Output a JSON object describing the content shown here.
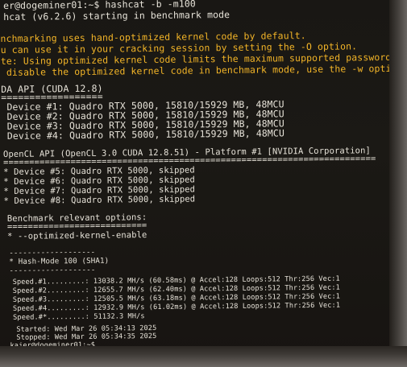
{
  "terminal": {
    "lines": {
      "l1": "er@dogeminer01:~$ hashcat -b -m100",
      "l2": "hcat (v6.2.6) starting in benchmark mode",
      "l3": "nchmarking uses hand-optimized kernel code by default.",
      "l4": "u can use it in your cracking session by setting the -O option.",
      "l5": "te: Using optimized kernel code limits the maximum supported password length.",
      "l6": " disable the optimized kernel code in benchmark mode, use the -w option.",
      "l7": "DA API (CUDA 12.8)",
      "l8": "==================",
      "l9": " Device #1: Quadro RTX 5000, 15810/15929 MB, 48MCU",
      "l10": " Device #2: Quadro RTX 5000, 15810/15929 MB, 48MCU",
      "l11": " Device #3: Quadro RTX 5000, 15810/15929 MB, 48MCU",
      "l12": " Device #4: Quadro RTX 5000, 15810/15929 MB, 48MCU",
      "l13": "OpenCL API (OpenCL 3.0 CUDA 12.8.51) - Platform #1 [NVIDIA Corporation]",
      "l14": "========================================================================",
      "l15": "* Device #5: Quadro RTX 5000, skipped",
      "l16": "* Device #6: Quadro RTX 5000, skipped",
      "l17": "* Device #7: Quadro RTX 5000, skipped",
      "l18": "* Device #8: Quadro RTX 5000, skipped",
      "l19": "Benchmark relevant options:",
      "l20": "===========================",
      "l21": "* --optimized-kernel-enable",
      "l22": "-------------------",
      "l23": "* Hash-Mode 100 (SHA1)",
      "l24": "-------------------",
      "l25": "Speed.#1.........: 13038.2 MH/s (60.58ms) @ Accel:128 Loops:512 Thr:256 Vec:1",
      "l26": "Speed.#2.........: 12655.7 MH/s (62.40ms) @ Accel:128 Loops:512 Thr:256 Vec:1",
      "l27": "Speed.#3.........: 12505.5 MH/s (63.18ms) @ Accel:128 Loops:512 Thr:256 Vec:1",
      "l28": "Speed.#4.........: 12932.9 MH/s (61.02ms) @ Accel:128 Loops:512 Thr:256 Vec:1",
      "l29": "Speed.#*.........: 51132.3 MH/s",
      "l30": "Started: Wed Mar 26 05:34:13 2025",
      "l31": "Stopped: Wed Mar 26 05:34:35 2025",
      "l32": "kajer@dogeminer01:~$"
    }
  },
  "colors": {
    "text": "#e6e2d8",
    "warning": "#f2b427",
    "background": "#1b1915"
  }
}
